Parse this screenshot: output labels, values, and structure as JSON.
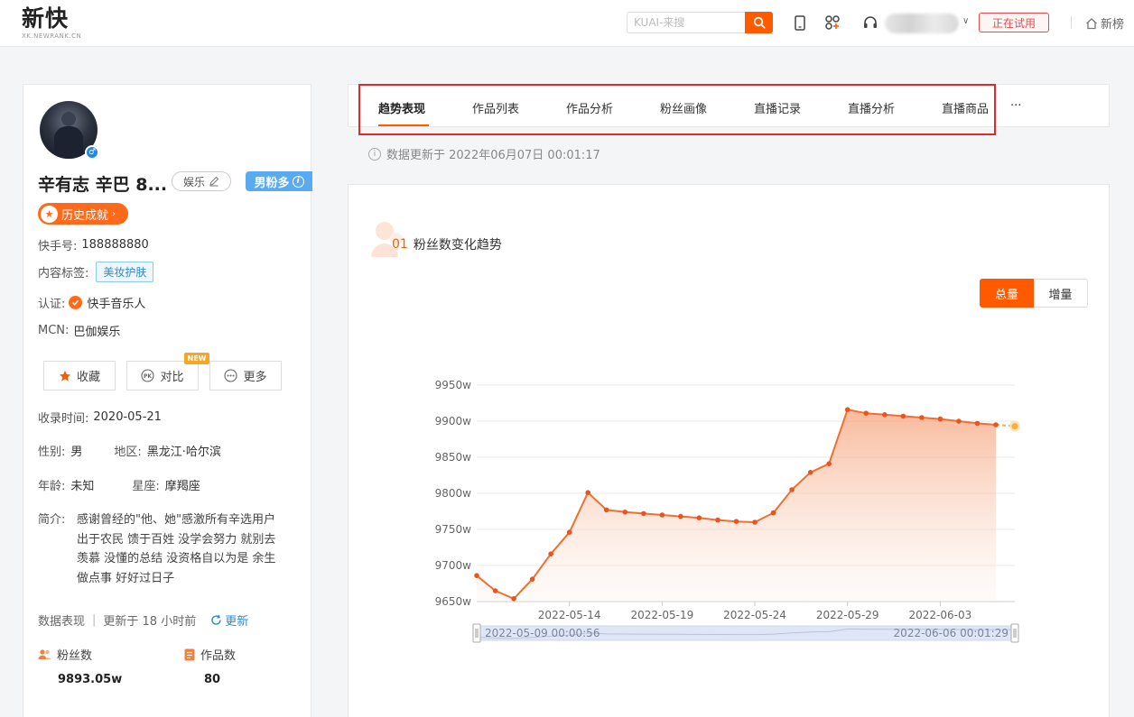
{
  "topbar": {
    "logo": "新快",
    "logo_sub": "XK.NEWRANK.CN",
    "search_placeholder": "KUAI-来搜",
    "trial_label": "正在试用",
    "newrank_label": "新榜"
  },
  "profile": {
    "name": "辛有志 辛巴 8...",
    "category": "娱乐",
    "fans_badge": "男粉多",
    "history_label": "历史成就",
    "kuaishou_id_label": "快手号:",
    "kuaishou_id": "188888880",
    "content_tag_label": "内容标签:",
    "content_tag": "美妆护肤",
    "verify_label": "认证:",
    "verify_value": "快手音乐人",
    "mcn_label": "MCN:",
    "mcn_value": "巴伽娱乐",
    "actions": {
      "favorite": "收藏",
      "compare": "对比",
      "more": "更多",
      "new_badge": "NEW"
    },
    "record_time_label": "收录时间:",
    "record_time": "2020-05-21",
    "gender_label": "性别:",
    "gender": "男",
    "region_label": "地区:",
    "region": "黑龙江·哈尔滨",
    "age_label": "年龄:",
    "age": "未知",
    "zodiac_label": "星座:",
    "zodiac": "摩羯座",
    "bio_label": "简介:",
    "bio_lines": [
      "感谢曾经的\"他、她\"感激所有辛选用户",
      "出于农民 馈于百姓 没学会努力 就别去",
      "羡慕 没懂的总结 没资格自以为是 余生",
      "做点事 好好过日子"
    ],
    "perf_label": "数据表现",
    "perf_updated": "更新于 18 小时前",
    "refresh_label": "更新",
    "fans_label": "粉丝数",
    "fans_value": "9893.05w",
    "works_label": "作品数",
    "works_value": "80"
  },
  "tabs": [
    "趋势表现",
    "作品列表",
    "作品分析",
    "粉丝画像",
    "直播记录",
    "直播分析",
    "直播商品",
    "···"
  ],
  "update_text": "数据更新于  2022年06月07日 00:01:17",
  "section": {
    "num": "01",
    "title": "粉丝数变化趋势"
  },
  "toggle": {
    "total": "总量",
    "delta": "增量"
  },
  "colors": {
    "accent": "#ff5a00",
    "line": "#f07030",
    "marker": "#e85520"
  },
  "chart_data": {
    "type": "area",
    "x": [
      "2022-05-09",
      "2022-05-10",
      "2022-05-11",
      "2022-05-12",
      "2022-05-13",
      "2022-05-14",
      "2022-05-15",
      "2022-05-16",
      "2022-05-17",
      "2022-05-18",
      "2022-05-19",
      "2022-05-20",
      "2022-05-21",
      "2022-05-22",
      "2022-05-23",
      "2022-05-24",
      "2022-05-25",
      "2022-05-26",
      "2022-05-27",
      "2022-05-28",
      "2022-05-29",
      "2022-05-30",
      "2022-05-31",
      "2022-06-01",
      "2022-06-02",
      "2022-06-03",
      "2022-06-04",
      "2022-06-05",
      "2022-06-06",
      "2022-06-07"
    ],
    "values": [
      9686,
      9665,
      9654,
      9681,
      9716,
      9746,
      9801,
      9777,
      9774,
      9772,
      9770,
      9768,
      9766,
      9763,
      9761,
      9760,
      9773,
      9805,
      9829,
      9841,
      9916,
      9911,
      9909,
      9907,
      9905,
      9903,
      9900,
      9897,
      9895,
      9893
    ],
    "projected_index": 29,
    "ylim": [
      9650,
      9950
    ],
    "yticks": [
      "9650w",
      "9700w",
      "9750w",
      "9800w",
      "9850w",
      "9900w",
      "9950w"
    ],
    "ytick_values": [
      9650,
      9700,
      9750,
      9800,
      9850,
      9900,
      9950
    ],
    "xticks": [
      "2022-05-14",
      "2022-05-19",
      "2022-05-24",
      "2022-05-29",
      "2022-06-03"
    ],
    "xtick_index": [
      5,
      10,
      15,
      20,
      25
    ],
    "grid": true,
    "zoom_start": "2022-05-09 00:00:56",
    "zoom_end": "2022-06-06 00:01:29"
  }
}
